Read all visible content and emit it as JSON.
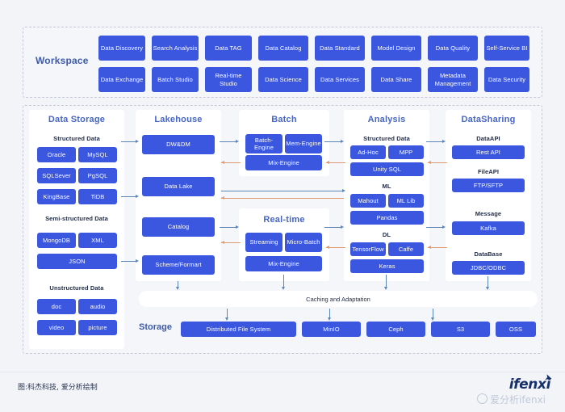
{
  "workspace": {
    "title": "Workspace",
    "row1": [
      "Data Discovery",
      "Search Analysis",
      "Data TAG",
      "Data Catalog",
      "Data Standard",
      "Model Design",
      "Data Quality",
      "Self-Service BI"
    ],
    "row2": [
      "Data Exchange",
      "Batch Studio",
      "Real-time Studio",
      "Data Science",
      "Data Services",
      "Data Share",
      "Metadata Management",
      "Data Security"
    ]
  },
  "columns": {
    "data_storage": {
      "title": "Data Storage",
      "groups": [
        {
          "label": "Structured Data",
          "items": [
            "Oracle",
            "MySQL",
            "SQLSever",
            "PgSQL",
            "KingBase",
            "TiDB"
          ]
        },
        {
          "label": "Semi-structured Data",
          "items": [
            "MongoDB",
            "XML",
            "JSON"
          ]
        },
        {
          "label": "Unstructured Data",
          "items": [
            "doc",
            "audio",
            "video",
            "picture"
          ]
        }
      ]
    },
    "lakehouse": {
      "title": "Lakehouse",
      "items": [
        "DW&DM",
        "Data Lake",
        "Catalog",
        "Scheme/Formart"
      ]
    },
    "batch": {
      "title": "Batch",
      "items": [
        "Batch-Engine",
        "Mem-Engine",
        "Mix-Engine"
      ]
    },
    "realtime": {
      "title": "Real-time",
      "items": [
        "Streaming",
        "Micro-Batch",
        "Mix-Engine"
      ]
    },
    "analysis": {
      "title": "Analysis",
      "groups": [
        {
          "label": "Structured Data",
          "items": [
            "Ad-Hoc",
            "MPP",
            "Unity SQL"
          ]
        },
        {
          "label": "ML",
          "items": [
            "Mahout",
            "ML Lib",
            "Pandas"
          ]
        },
        {
          "label": "DL",
          "items": [
            "TensorFlow",
            "Caffe",
            "Keras"
          ]
        }
      ]
    },
    "datasharing": {
      "title": "DataSharing",
      "groups": [
        {
          "label": "DataAPI",
          "items": [
            "Rest API"
          ]
        },
        {
          "label": "FileAPI",
          "items": [
            "FTP/SFTP"
          ]
        },
        {
          "label": "Message",
          "items": [
            "Kafka"
          ]
        },
        {
          "label": "DataBase",
          "items": [
            "JDBC/ODBC"
          ]
        }
      ]
    }
  },
  "caching": {
    "label": "Caching and Adaptation"
  },
  "storage": {
    "label": "Storage",
    "items": [
      "Distributed File System",
      "MinIO",
      "Ceph",
      "S3",
      "OSS"
    ]
  },
  "footer": {
    "caption": "图:科杰科技, 爱分析绘制",
    "brand": "ifenxi",
    "watermark": "爱分析ifenxi"
  },
  "colors": {
    "chip": "#3b57e0",
    "title": "#4766c4",
    "background": "#f2f4f8",
    "panel": "#ffffff",
    "arrow_blue": "#5b86b5",
    "arrow_orange": "#e09a72"
  }
}
